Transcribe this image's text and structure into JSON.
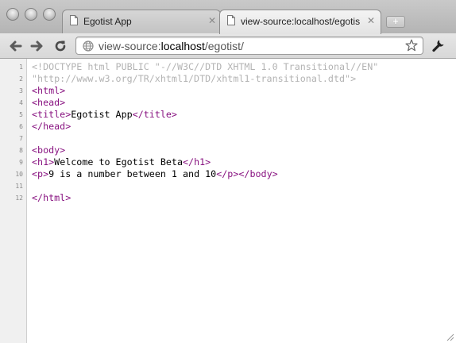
{
  "tabs": [
    {
      "title": "Egotist App",
      "active": false
    },
    {
      "title": "view-source:localhost/egotis",
      "active": true
    }
  ],
  "toolbar": {
    "url_scheme": "view-source:",
    "url_host": "localhost",
    "url_path": "/egotist/"
  },
  "source": {
    "lines": [
      {
        "num": "1",
        "tokens": [
          {
            "type": "doctype",
            "text": "<!DOCTYPE html PUBLIC \"-//W3C//DTD XHTML 1.0 Transitional//EN\""
          }
        ]
      },
      {
        "num": "2",
        "tokens": [
          {
            "type": "doctype",
            "text": "\"http://www.w3.org/TR/xhtml1/DTD/xhtml1-transitional.dtd\">"
          }
        ]
      },
      {
        "num": "3",
        "tokens": [
          {
            "type": "tag",
            "text": "<html>"
          }
        ]
      },
      {
        "num": "4",
        "tokens": [
          {
            "type": "tag",
            "text": "<head>"
          }
        ]
      },
      {
        "num": "5",
        "tokens": [
          {
            "type": "tag",
            "text": "<title>"
          },
          {
            "type": "text",
            "text": "Egotist App"
          },
          {
            "type": "tag",
            "text": "</title>"
          }
        ]
      },
      {
        "num": "6",
        "tokens": [
          {
            "type": "tag",
            "text": "</head>"
          }
        ]
      },
      {
        "num": "7",
        "tokens": []
      },
      {
        "num": "8",
        "tokens": [
          {
            "type": "tag",
            "text": "<body>"
          }
        ]
      },
      {
        "num": "9",
        "tokens": [
          {
            "type": "tag",
            "text": "<h1>"
          },
          {
            "type": "text",
            "text": "Welcome to Egotist Beta"
          },
          {
            "type": "tag",
            "text": "</h1>"
          }
        ]
      },
      {
        "num": "10",
        "tokens": [
          {
            "type": "tag",
            "text": "<p>"
          },
          {
            "type": "text",
            "text": "9 is a number between 1 and 10"
          },
          {
            "type": "tag",
            "text": "</p>"
          },
          {
            "type": "tag",
            "text": "</body>"
          }
        ]
      },
      {
        "num": "11",
        "tokens": []
      },
      {
        "num": "12",
        "tokens": [
          {
            "type": "tag",
            "text": "</html>"
          }
        ]
      }
    ]
  },
  "colors": {
    "tag": "#881280",
    "doctype": "#b3b3b3",
    "text": "#000000"
  }
}
